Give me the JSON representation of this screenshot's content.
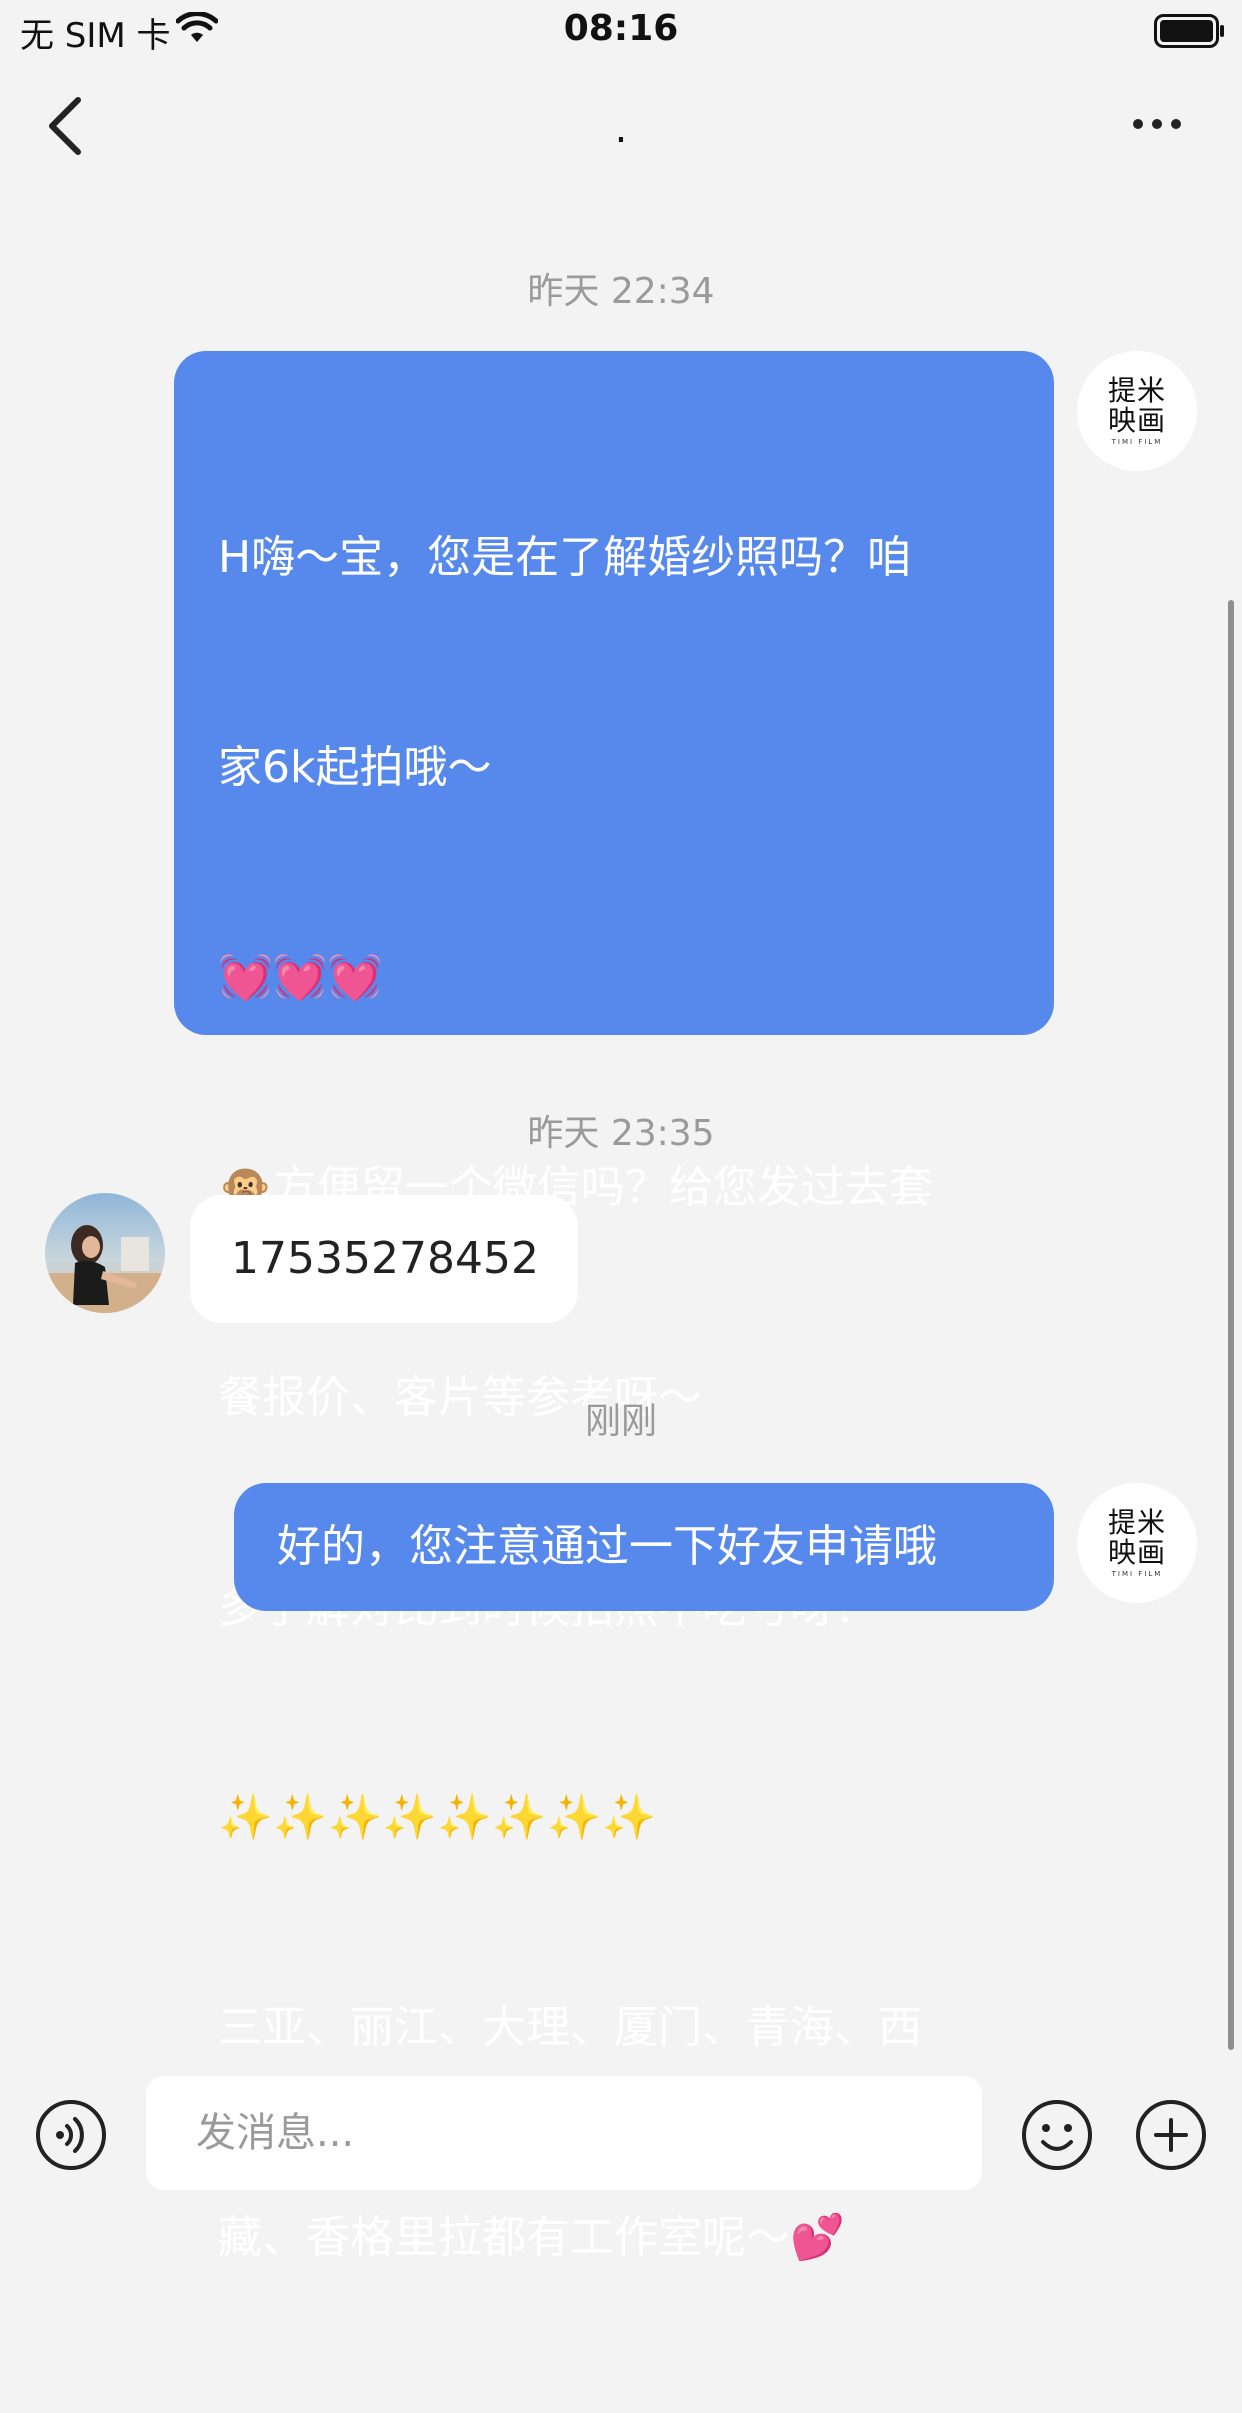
{
  "status_bar": {
    "carrier": "无 SIM 卡",
    "time": "08:16"
  },
  "nav": {
    "title": "."
  },
  "messages": [
    {
      "timestamp": "昨天 22:34"
    },
    {
      "direction": "out",
      "avatar_text": "提米映画",
      "avatar_sub": "TIMI FILM",
      "lines": [
        "H嗨～宝，您是在了解婚纱照吗？咱",
        "家6k起拍哦～",
        "💓💓💓",
        "🙊方便留一个微信吗？给您发过去套",
        "餐报价、客片等参考呀～",
        "多了解对比到时候拍照不吃亏呀！",
        "✨✨✨✨✨✨✨✨",
        "三亚、丽江、大理、厦门、青海、西",
        "藏、香格里拉都有工作室呢～💕"
      ]
    },
    {
      "timestamp": "昨天 23:35"
    },
    {
      "direction": "in",
      "text": "17535278452"
    },
    {
      "timestamp": "刚刚"
    },
    {
      "direction": "out",
      "avatar_text": "提米映画",
      "avatar_sub": "TIMI FILM",
      "text": "好的，您注意通过一下好友申请哦"
    }
  ],
  "input": {
    "placeholder": "发消息..."
  },
  "icons": {
    "back": "chevron-left-icon",
    "more": "more-dots-icon",
    "voice": "voice-icon",
    "emoji": "emoji-icon",
    "plus": "plus-circle-icon"
  },
  "colors": {
    "outgoing_bubble": "#5689eb",
    "incoming_bubble": "#ffffff",
    "background": "#f3f3f4",
    "timestamp": "#9a9a9a"
  }
}
